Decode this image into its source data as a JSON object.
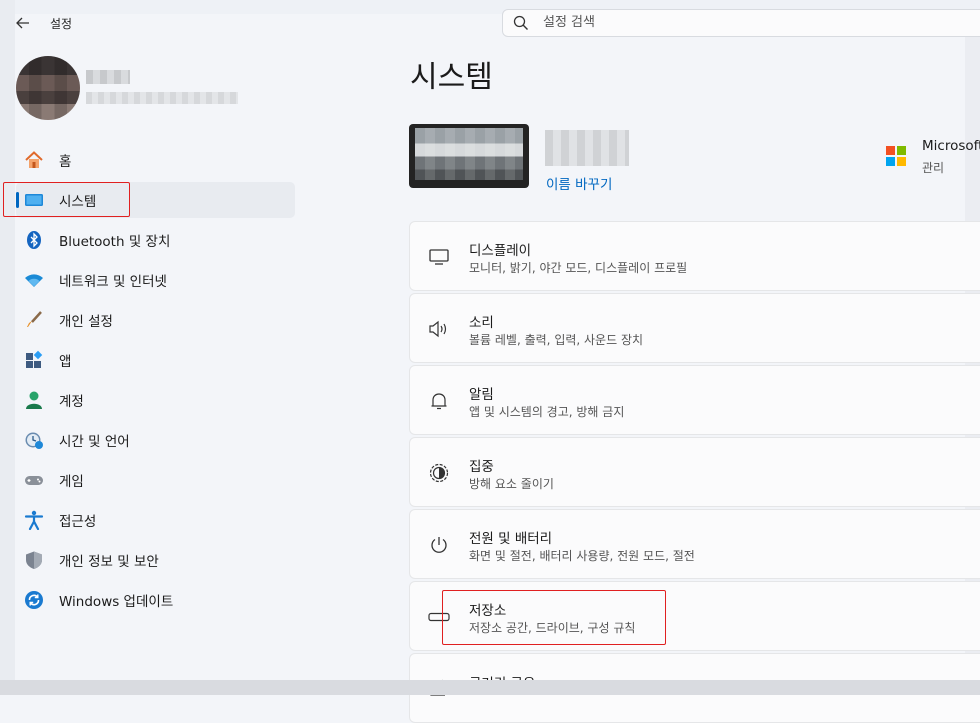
{
  "app": {
    "title": "설정"
  },
  "search": {
    "placeholder": "설정 검색"
  },
  "sidebar": {
    "items": [
      {
        "label": "홈"
      },
      {
        "label": "시스템"
      },
      {
        "label": "Bluetooth 및 장치"
      },
      {
        "label": "네트워크 및 인터넷"
      },
      {
        "label": "개인 설정"
      },
      {
        "label": "앱"
      },
      {
        "label": "계정"
      },
      {
        "label": "시간 및 언어"
      },
      {
        "label": "게임"
      },
      {
        "label": "접근성"
      },
      {
        "label": "개인 정보 및 보안"
      },
      {
        "label": "Windows 업데이트"
      }
    ],
    "selected": "시스템"
  },
  "main": {
    "title": "시스템",
    "device": {
      "rename_link": "이름 바꾸기"
    },
    "microsoft": {
      "title": "Microsoft",
      "subtitle": "관리"
    },
    "cards": [
      {
        "title": "디스플레이",
        "subtitle": "모니터, 밝기, 야간 모드, 디스플레이 프로필",
        "icon": "monitor-icon"
      },
      {
        "title": "소리",
        "subtitle": "볼륨 레벨, 출력, 입력, 사운드 장치",
        "icon": "speaker-icon"
      },
      {
        "title": "알림",
        "subtitle": "앱 및 시스템의 경고, 방해 금지",
        "icon": "bell-icon"
      },
      {
        "title": "집중",
        "subtitle": "방해 요소 줄이기",
        "icon": "focus-icon"
      },
      {
        "title": "전원 및 배터리",
        "subtitle": "화면 및 절전, 배터리 사용량, 전원 모드, 절전",
        "icon": "power-icon"
      },
      {
        "title": "저장소",
        "subtitle": "저장소 공간, 드라이브, 구성 규칙",
        "icon": "storage-icon"
      },
      {
        "title": "근거리 공유",
        "subtitle": "",
        "icon": "share-icon"
      }
    ]
  },
  "colors": {
    "accent": "#0067c0",
    "highlight_box": "#e02020"
  }
}
